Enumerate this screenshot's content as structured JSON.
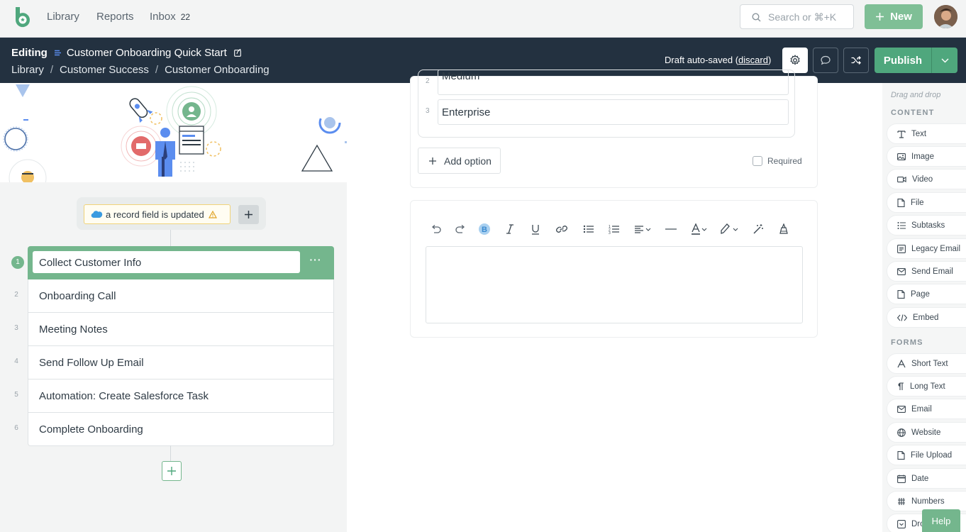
{
  "topnav": {
    "links": {
      "library": "Library",
      "reports": "Reports",
      "inbox": "Inbox"
    },
    "inbox_count": "22",
    "search_placeholder": "Search or ⌘+K",
    "new_label": "New"
  },
  "editbar": {
    "mode": "Editing",
    "workflow_title": "Customer Onboarding Quick Start",
    "breadcrumb": [
      "Library",
      "Customer Success",
      "Customer Onboarding"
    ],
    "autosave_prefix": "Draft auto-saved (",
    "autosave_link": "discard",
    "autosave_suffix": ")",
    "publish_label": "Publish"
  },
  "workflow": {
    "trigger": "a record field is updated",
    "tasks": [
      {
        "num": "1",
        "label": "Collect Customer Info",
        "active": true
      },
      {
        "num": "2",
        "label": "Onboarding Call"
      },
      {
        "num": "3",
        "label": "Meeting Notes"
      },
      {
        "num": "4",
        "label": "Send Follow Up Email"
      },
      {
        "num": "5",
        "label": "Automation: Create Salesforce Task"
      },
      {
        "num": "6",
        "label": "Complete Onboarding"
      }
    ]
  },
  "form": {
    "options": [
      {
        "num": "2",
        "label": "Medium"
      },
      {
        "num": "3",
        "label": "Enterprise"
      }
    ],
    "add_option": "Add option",
    "required": "Required",
    "toolbar_icons": [
      "undo-icon",
      "redo-icon",
      "bold-icon",
      "italic-icon",
      "underline-icon",
      "link-icon",
      "bullet-list-icon",
      "numbered-list-icon",
      "align-icon",
      "horizontal-rule-icon",
      "text-color-icon",
      "highlight-icon",
      "magic-wand-icon",
      "clear-format-icon"
    ]
  },
  "sidebar": {
    "hint": "Drag and drop",
    "content_heading": "CONTENT",
    "content_items": [
      "Text",
      "Image",
      "Video",
      "File",
      "Subtasks",
      "Legacy Email",
      "Send Email",
      "Page",
      "Embed"
    ],
    "forms_heading": "FORMS",
    "form_items": [
      "Short Text",
      "Long Text",
      "Email",
      "Website",
      "File Upload",
      "Date",
      "Numbers",
      "Dropdown"
    ]
  },
  "help_label": "Help",
  "colors": {
    "brand_green": "#4fa77d",
    "task_green": "#74b68d",
    "header_dark": "#233140"
  }
}
